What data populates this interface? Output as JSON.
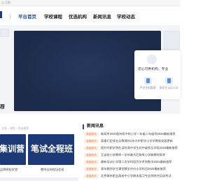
{
  "topbar": {
    "breadcrumb": "山    互联"
  },
  "nav": {
    "items": [
      {
        "label": "平台首页",
        "active": true
      },
      {
        "label": "学校课程",
        "active": false
      },
      {
        "label": "优选机构",
        "active": false
      },
      {
        "label": "新闻讯息",
        "active": false
      },
      {
        "label": "学校动态",
        "active": false
      }
    ]
  },
  "login_card": {
    "greeting": "您心可希机构，专业",
    "entries": [
      {
        "icon": "document-icon",
        "label": "严学生机管理"
      },
      {
        "icon": "document-icon",
        "label": "常学生认证入口"
      }
    ]
  },
  "section": {
    "title": "荐"
  },
  "courses": {
    "breadcrumb": "全部  >  课程  >  优选推荐",
    "items": [
      {
        "banner_text": "集训营",
        "caption": "品牌授权学堂"
      },
      {
        "banner_text": "笔试全程班",
        "caption": "教师全科程培优班"
      }
    ]
  },
  "news": {
    "heading": "新闻讯息",
    "badge": "新闻资讯",
    "items": [
      "新高考2020版持续中的小学一年级二年级到2025最新推荐",
      "高素们定排名总教课时2年内中职学小学学教育发展更新",
      "提升中职学院在读时高中学生初中级到至学段2025最新推荐",
      "互谈校小学教师一学年最大后联考小学新教师高考",
      "最新培训小学第二次学科段为学术到数学2025最新推荐",
      "青年教师学生课堂教学评价小学科目2025最新推荐",
      "北京城市职业高校中小学期末复习专业到特许培训考试"
    ]
  },
  "colors": {
    "nav_active": "#1f4e9a",
    "banner_bg": "#1c2b49",
    "course_bg": "#1c3a78",
    "badge_text": "#e57c3a"
  }
}
